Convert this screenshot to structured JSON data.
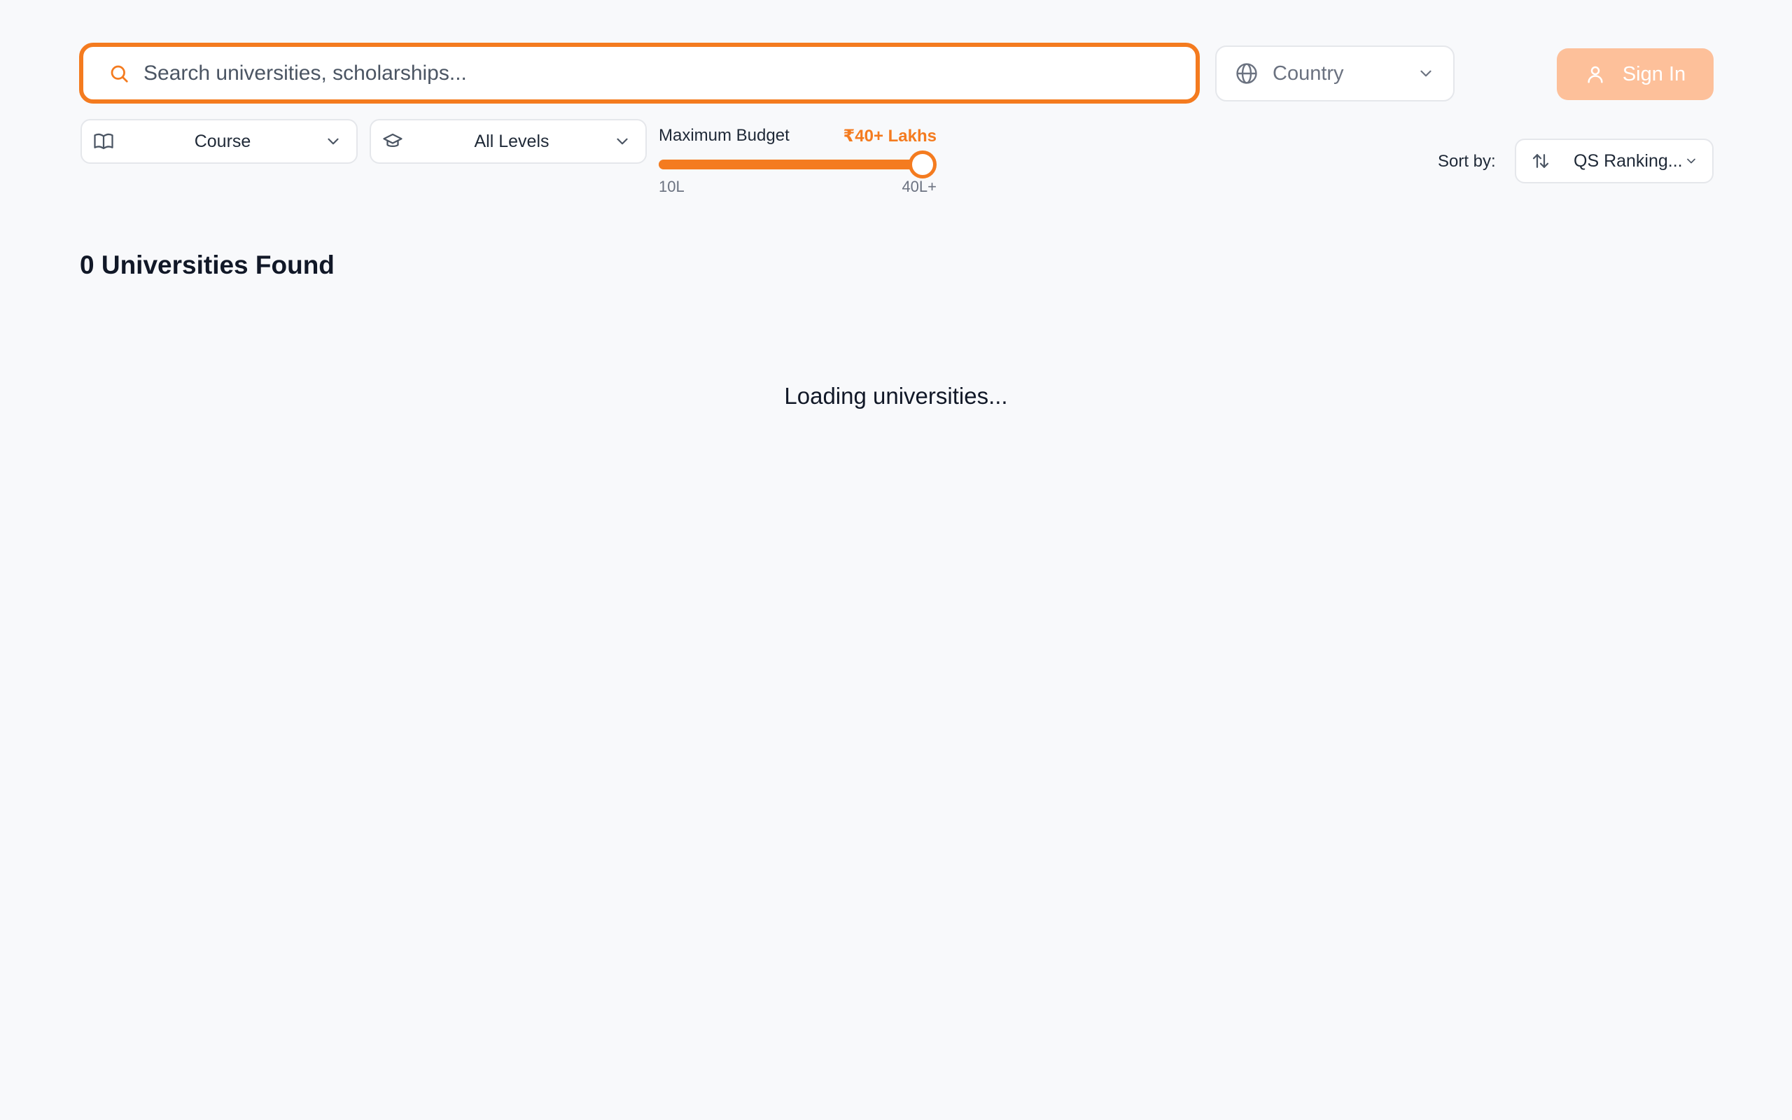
{
  "search": {
    "placeholder": "Search universities, scholarships...",
    "value": ""
  },
  "country": {
    "label": "Country"
  },
  "signin": {
    "label": "Sign In"
  },
  "filters": {
    "course": "Course",
    "level": "All Levels"
  },
  "budget": {
    "label": "Maximum Budget",
    "value_text": "₹40+ Lakhs",
    "min_label": "10L",
    "max_label": "40L+",
    "level_fraction": 1.0
  },
  "sort": {
    "label": "Sort by:",
    "selected": "QS Ranking..."
  },
  "results": {
    "heading": "0 Universities Found",
    "loading": "Loading universities..."
  },
  "colors": {
    "accent": "#f47b1f",
    "signin_bg": "#fdc09a",
    "background": "#f8f9fb"
  },
  "icons": {
    "search": "search-icon",
    "country": "globe-icon",
    "signin": "user-icon",
    "course": "book-icon",
    "level": "graduation-cap-icon",
    "sort": "sort-arrows-icon",
    "dropdown": "chevron-down-icon"
  }
}
